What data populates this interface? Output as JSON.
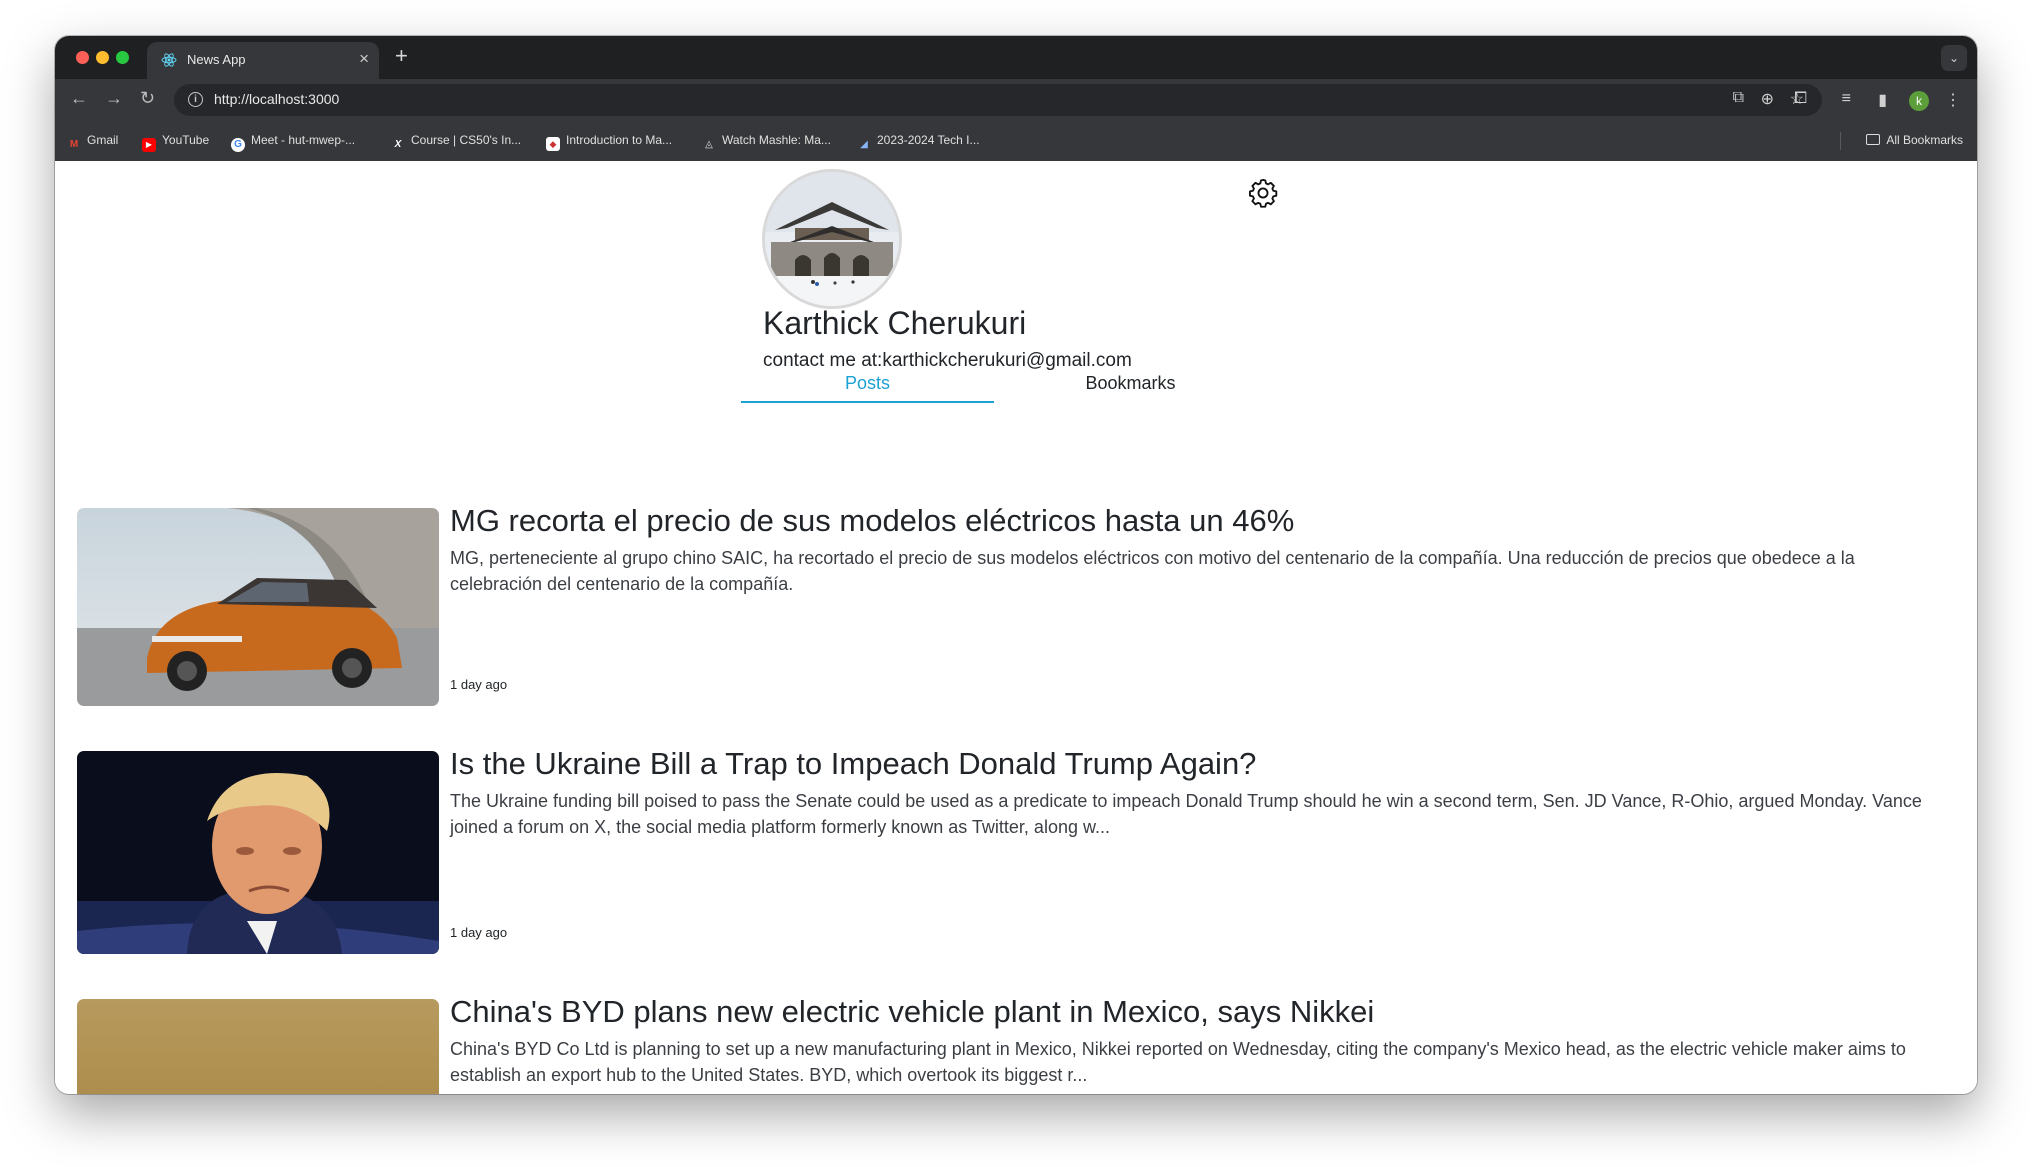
{
  "browser": {
    "tab_title": "News App",
    "tab_close": "×",
    "new_tab": "+",
    "url": "http://localhost:3000",
    "profile_initial": "k",
    "bookmarks": [
      {
        "label": "Gmail",
        "icon": "gmail-icon"
      },
      {
        "label": "YouTube",
        "icon": "youtube-icon"
      },
      {
        "label": "Meet - hut-mwep-...",
        "icon": "google-icon"
      },
      {
        "label": "Course | CS50's In...",
        "icon": "x-icon"
      },
      {
        "label": "Introduction to Ma...",
        "icon": "site-icon"
      },
      {
        "label": "Watch Mashle: Ma...",
        "icon": "crunchyroll-icon"
      },
      {
        "label": "2023-2024 Tech I...",
        "icon": "chart-icon"
      }
    ],
    "all_bookmarks": "All Bookmarks"
  },
  "profile": {
    "name": "Karthick Cherukuri",
    "contact": "contact me at:karthickcherukuri@gmail.com"
  },
  "tabs": {
    "posts": "Posts",
    "bookmarks": "Bookmarks"
  },
  "posts": [
    {
      "title": "MG recorta el precio de sus modelos eléctricos hasta un 46%",
      "description": "MG, perteneciente al grupo chino SAIC, ha recortado el precio de sus modelos eléctricos con motivo del centenario de la compañía. Una reducción de precios que obedece a la celebración del centenario de la compañía.",
      "time": "1 day ago"
    },
    {
      "title": "Is the Ukraine Bill a Trap to Impeach Donald Trump Again?",
      "description": "The Ukraine funding bill poised to pass the Senate could be used as a predicate to impeach Donald Trump should he win a second term, Sen. JD Vance, R-Ohio, argued Monday.  Vance joined a forum on X, the social media platform formerly known as Twitter, along w...",
      "time": "1 day ago"
    },
    {
      "title": "China's BYD plans new electric vehicle plant in Mexico, says Nikkei",
      "description": "China's BYD Co Ltd is planning to set up a new manufacturing plant in Mexico, Nikkei reported on Wednesday, citing the company's Mexico head, as the electric vehicle maker aims to establish an export hub to the United States. BYD, which overtook its biggest r...",
      "time": ""
    }
  ],
  "colors": {
    "accent": "#1ba1d4",
    "text": "#212529",
    "chrome_dark": "#1f2022",
    "chrome_toolbar": "#36373a"
  }
}
